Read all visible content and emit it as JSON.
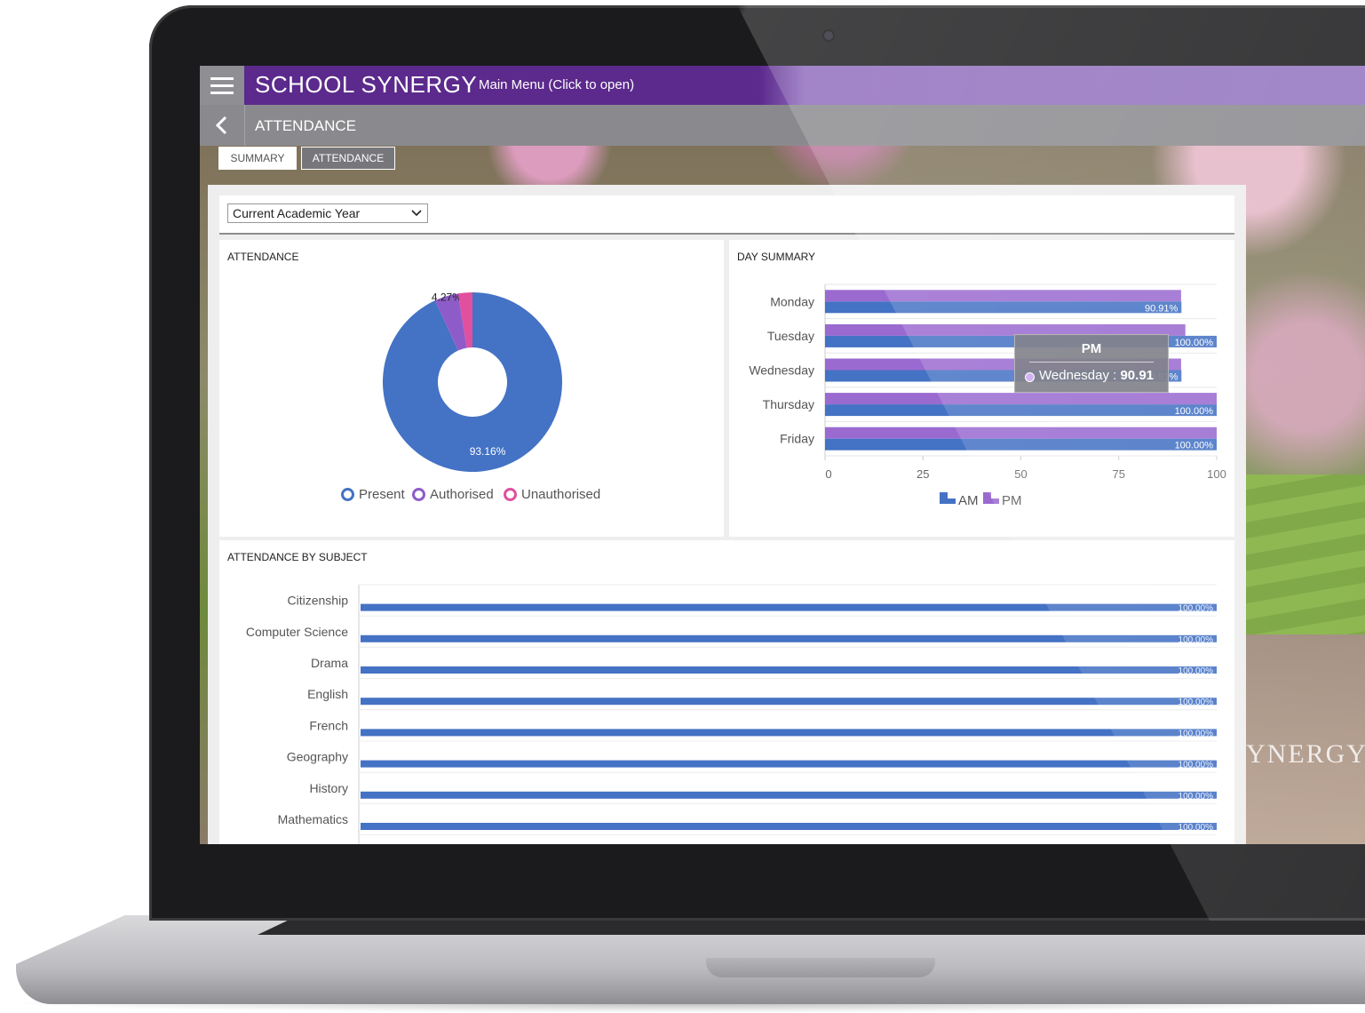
{
  "app": {
    "brand": "SCHOOL SYNERGY",
    "main_menu": "Main Menu (Click to open)",
    "page_title": "ATTENDANCE",
    "watermark": "YNERGY S"
  },
  "tabs": [
    {
      "label": "SUMMARY",
      "active": false
    },
    {
      "label": "ATTENDANCE",
      "active": true
    }
  ],
  "filter": {
    "selected": "Current Academic Year"
  },
  "colors": {
    "header": "#5b2a8c",
    "present": "#4472c4",
    "authorised": "#8e5cc9",
    "unauthorised": "#e0509f",
    "am": "#4472c4",
    "pm": "#9a6ad0"
  },
  "panels": {
    "attendance_title": "ATTENDANCE",
    "day_summary_title": "DAY SUMMARY",
    "by_subject_title": "ATTENDANCE BY SUBJECT"
  },
  "icons": [
    "menu-icon",
    "back-chevron-icon",
    "dropdown-caret-icon"
  ],
  "chart_data": [
    {
      "type": "pie",
      "title": "ATTENDANCE",
      "labels": [
        "Present",
        "Authorised",
        "Unauthorised"
      ],
      "values": [
        93.16,
        4.27,
        2.57
      ],
      "data_labels": [
        "93.16%",
        "4.27%",
        ""
      ],
      "legend": "bottom",
      "donut": true
    },
    {
      "type": "bar",
      "orientation": "horizontal",
      "title": "DAY SUMMARY",
      "categories": [
        "Monday",
        "Tuesday",
        "Wednesday",
        "Thursday",
        "Friday"
      ],
      "series": [
        {
          "name": "AM",
          "values": [
            91,
            100,
            91,
            100,
            100
          ]
        },
        {
          "name": "PM",
          "values": [
            90.91,
            92,
            90.91,
            100,
            100
          ]
        }
      ],
      "data_labels": [
        "90.91%",
        "100.00%",
        "90.91%",
        "100.00%",
        "100.00%"
      ],
      "xticks": [
        "0",
        "25",
        "50",
        "75",
        "100"
      ],
      "xlim": [
        0,
        100
      ],
      "legend": "bottom",
      "tooltip": {
        "title": "PM",
        "label": "Wednesday",
        "value": "90.91"
      }
    },
    {
      "type": "bar",
      "orientation": "horizontal",
      "title": "ATTENDANCE BY SUBJECT",
      "categories": [
        "Citizenship",
        "Computer Science",
        "Drama",
        "English",
        "French",
        "Geography",
        "History",
        "Mathematics"
      ],
      "values": [
        100,
        100,
        100,
        100,
        100,
        100,
        100,
        100
      ],
      "data_labels": [
        "100.00%",
        "100.00%",
        "100.00%",
        "100.00%",
        "100.00%",
        "100.00%",
        "100.00%",
        "100.00%"
      ],
      "xlim": [
        0,
        100
      ]
    }
  ]
}
